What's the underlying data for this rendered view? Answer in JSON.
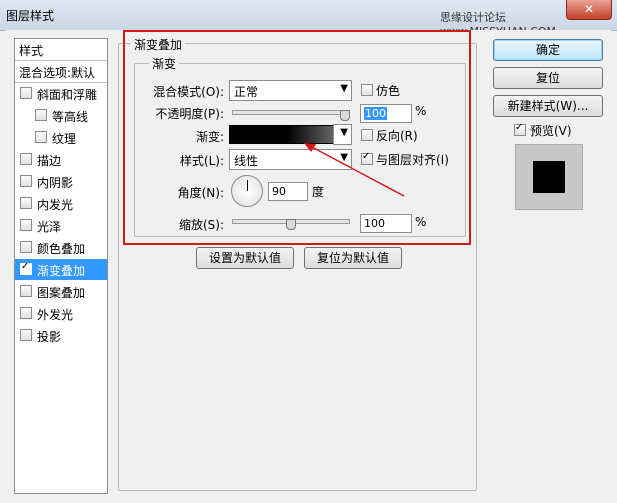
{
  "window": {
    "title": "图层样式",
    "watermark": "思缘设计论坛 www.MISSYUAN.COM",
    "close": "✕"
  },
  "left_panel": {
    "items": [
      {
        "label": "样式",
        "type": "header"
      },
      {
        "label": "混合选项:默认",
        "type": "header"
      },
      {
        "label": "斜面和浮雕",
        "checked": false
      },
      {
        "label": "等高线",
        "checked": false,
        "indent": true
      },
      {
        "label": "纹理",
        "checked": false,
        "indent": true
      },
      {
        "label": "描边",
        "checked": false
      },
      {
        "label": "内阴影",
        "checked": false
      },
      {
        "label": "内发光",
        "checked": false
      },
      {
        "label": "光泽",
        "checked": false
      },
      {
        "label": "颜色叠加",
        "checked": false
      },
      {
        "label": "渐变叠加",
        "checked": true,
        "selected": true
      },
      {
        "label": "图案叠加",
        "checked": false
      },
      {
        "label": "外发光",
        "checked": false
      },
      {
        "label": "投影",
        "checked": false
      }
    ]
  },
  "gradient_overlay": {
    "group_title": "渐变叠加",
    "sub_title": "渐变",
    "blend_mode_label": "混合模式(O):",
    "blend_mode_value": "正常",
    "dither_label": "仿色",
    "dither_checked": false,
    "opacity_label": "不透明度(P):",
    "opacity_value": "100",
    "opacity_unit": "%",
    "opacity_level": 1.0,
    "gradient_label": "渐变:",
    "reverse_label": "反向(R)",
    "reverse_checked": false,
    "style_label": "样式(L):",
    "style_value": "线性",
    "align_label": "与图层对齐(I)",
    "align_checked": true,
    "angle_label": "角度(N):",
    "angle_value": "90",
    "angle_unit": "度",
    "scale_label": "缩放(S):",
    "scale_value": "100",
    "scale_unit": "%",
    "scale_level": 0.5
  },
  "buttons": {
    "make_default": "设置为默认值",
    "reset_default": "复位为默认值",
    "ok": "确定",
    "reset": "复位",
    "new_style": "新建样式(W)...",
    "preview_label": "预览(V)",
    "preview_checked": true
  },
  "colors": {
    "highlight": "#d01a1a",
    "selection": "#3399ff"
  }
}
